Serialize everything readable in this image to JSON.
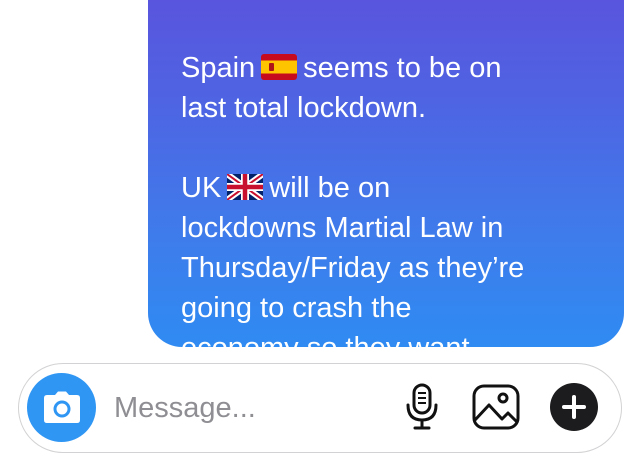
{
  "message": {
    "line1_before_flag": "Spain",
    "line1_after_flag": "seems to be on",
    "line2": "last total lockdown.",
    "line3_before_flag": "UK",
    "line3_after_flag": "will be on",
    "lines_rest": "lockdowns Martial Law in\nThursday/Friday as they’re\ngoing to crash the\neconomy so they want\neveryone indoors !"
  },
  "composer": {
    "placeholder": "Message..."
  },
  "icons": {
    "camera": "camera-icon",
    "mic": "microphone-icon",
    "gallery": "image-gallery-icon",
    "plus": "plus-icon",
    "flag_spain": "spain-flag-icon",
    "flag_uk": "uk-flag-icon"
  },
  "colors": {
    "bubble_top": "#5d4fdc",
    "bubble_bottom": "#2f8bf2",
    "camera_button": "#2f96f4",
    "plus_button": "#1c1c1e",
    "placeholder_text": "#8e8e93"
  }
}
